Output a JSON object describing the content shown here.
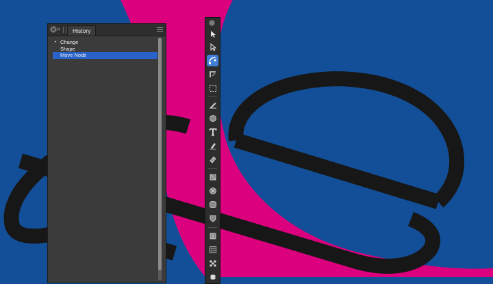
{
  "canvas": {
    "background_color": "#124f98",
    "accent_shape_color": "#db007e",
    "stroke_color": "#171717"
  },
  "history_panel": {
    "tab_label": "History",
    "items": [
      {
        "label": "Change",
        "bullet": "▸",
        "selected": false
      },
      {
        "label": "Shape",
        "bullet": "",
        "selected": false
      },
      {
        "label": "Move Node",
        "bullet": "",
        "selected": true
      }
    ],
    "selection_color": "#2962c9"
  },
  "tools_panel": {
    "active_tool": "node-tool",
    "tools": [
      "move-tool",
      "node-tool-arrow",
      "node-tool",
      "corner-tool",
      "marquee-tool",
      "pencil-tool",
      "ellipse-tool",
      "text-tool",
      "fill-tool",
      "transparency-tool",
      "shape-tool",
      "ellipse-shape-tool",
      "rounded-rect-tool",
      "shield-tool",
      "crop-tool",
      "grid-tool",
      "pattern-tool",
      "gear-tool"
    ]
  }
}
